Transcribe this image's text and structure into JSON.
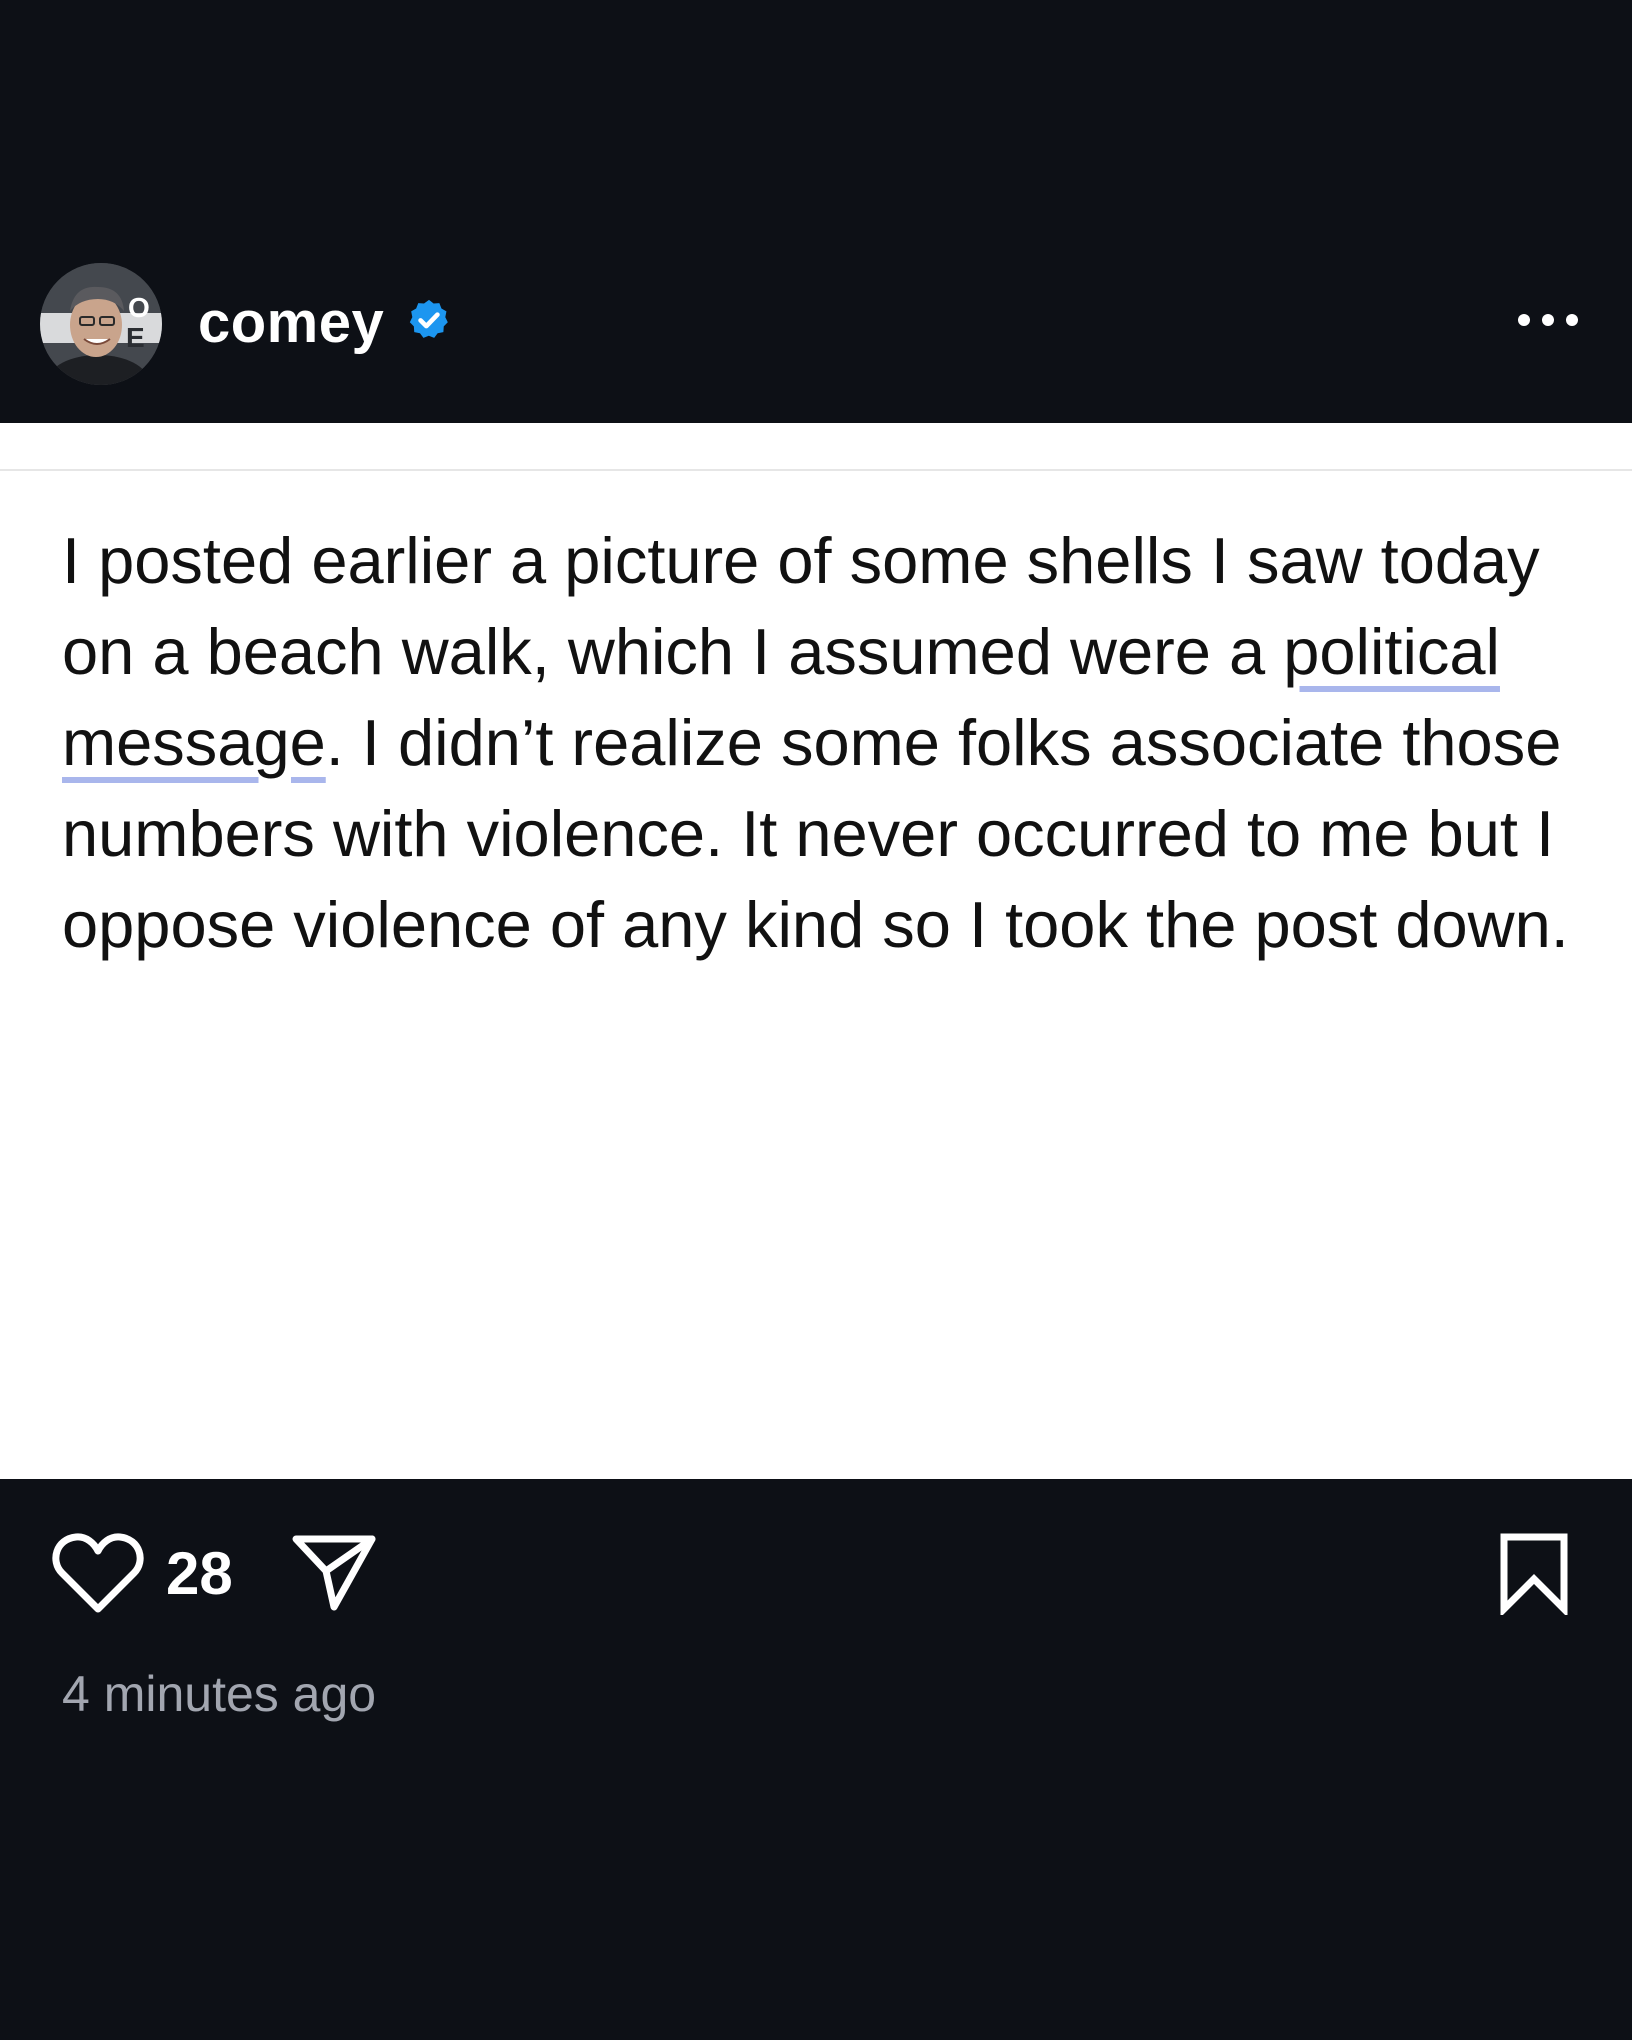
{
  "post": {
    "username": "comey",
    "verified": true,
    "text": {
      "part1": "I posted earlier a picture of some shells I saw today on a beach walk, which I assumed were a ",
      "link1": "political",
      "sep": " ",
      "link2": "message",
      "part2": ". I didn’t realize some folks associate those numbers with violence. It never occurred to me but I oppose violence of any kind so I took the post down."
    },
    "likes": "28",
    "timestamp": "4 minutes ago"
  },
  "icons": {
    "avatar": "profile-photo",
    "verified": "verified-badge-icon",
    "more": "more-options-icon",
    "like": "heart-icon",
    "share": "send-icon",
    "save": "bookmark-icon"
  },
  "colors": {
    "background": "#0d1016",
    "card": "#ffffff",
    "verified": "#1c96f0",
    "highlight_underline": "#a9b6ec",
    "timestamp": "#a2a6b0"
  }
}
